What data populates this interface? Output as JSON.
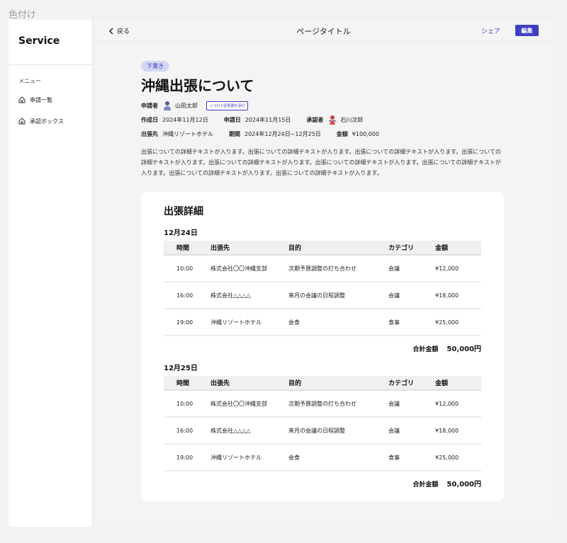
{
  "frame_label": "色付け",
  "sidebar": {
    "brand": "Service",
    "menu_label": "メニュー",
    "items": [
      {
        "label": "申請一覧"
      },
      {
        "label": "承認ボックス"
      }
    ]
  },
  "topbar": {
    "back_label": "戻る",
    "page_title": "ページタイトル",
    "share_label": "シェア",
    "edit_label": "編集"
  },
  "request": {
    "badge": "下書き",
    "title": "沖縄出張について",
    "applicant_key": "申請者",
    "applicant": "山田太郎",
    "cert_button": "+コロナ証明書を添付",
    "created_key": "作成日",
    "created": "2024年11月12日",
    "applied_key": "申請日",
    "applied": "2024年11月15日",
    "approver_key": "承認者",
    "approver": "石川次郎",
    "destination_key": "出張先",
    "destination": "沖縄リゾートホテル",
    "period_key": "期間",
    "period": "2024年12月24日~12月25日",
    "amount_key": "金額",
    "amount": "¥100,000",
    "description": "出張についての詳細テキストが入ります。出張についての詳細テキストが入ります。出張についての詳細テキストが入ります。出張についての詳細テキストが入ります。出張についての詳細テキストが入ります。出張についての詳細テキストが入ります。出張についての詳細テキストが入ります。出張についての詳細テキストが入ります。出張についての詳細テキストが入ります。"
  },
  "details": {
    "title": "出張詳細",
    "columns": [
      "時間",
      "出張先",
      "目的",
      "カテゴリ",
      "金額"
    ],
    "total_label": "合計金額",
    "days": [
      {
        "date": "12月24日",
        "rows": [
          [
            "10:00",
            "株式会社〇〇沖縄支部",
            "次期予算調整の打ち合わせ",
            "会議",
            "¥12,000"
          ],
          [
            "16:00",
            "株式会社△△△△",
            "来月の会議の日程調整",
            "会議",
            "¥18,000"
          ],
          [
            "19:00",
            "沖縄リゾートホテル",
            "会食",
            "食事",
            "¥25,000"
          ]
        ],
        "total": "50,000円"
      },
      {
        "date": "12月25日",
        "rows": [
          [
            "10:00",
            "株式会社〇〇沖縄支部",
            "次期予算調整の打ち合わせ",
            "会議",
            "¥12,000"
          ],
          [
            "16:00",
            "株式会社△△△△",
            "来月の会議の日程調整",
            "会議",
            "¥18,000"
          ],
          [
            "19:00",
            "沖縄リゾートホテル",
            "会食",
            "食事",
            "¥25,000"
          ]
        ],
        "total": "50,000円"
      }
    ]
  },
  "colors": {
    "accent": "#3f3fbf",
    "badge_bg": "#d5d5f5",
    "background": "#f4f4f4"
  }
}
